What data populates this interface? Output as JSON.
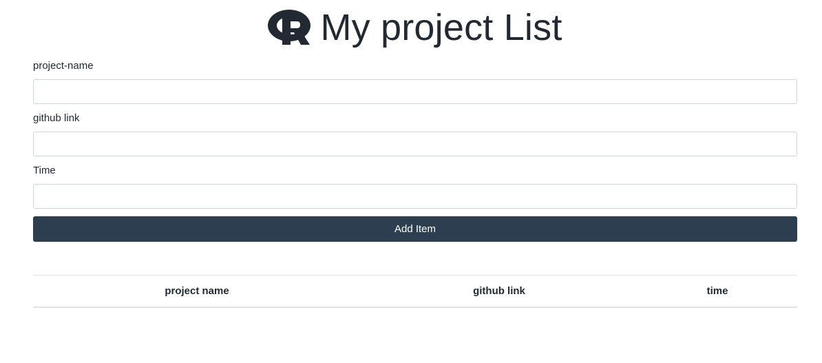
{
  "header": {
    "title": "My project List",
    "logo_icon": "r-logo-icon"
  },
  "form": {
    "fields": [
      {
        "label": "project-name",
        "value": "",
        "placeholder": ""
      },
      {
        "label": "github link",
        "value": "",
        "placeholder": ""
      },
      {
        "label": "Time",
        "value": "",
        "placeholder": ""
      }
    ],
    "submit_label": "Add Item"
  },
  "table": {
    "columns": [
      "project name",
      "github link",
      "time"
    ],
    "rows": []
  },
  "colors": {
    "primary": "#2c3e50",
    "text": "#222933",
    "border": "#ced4da"
  }
}
